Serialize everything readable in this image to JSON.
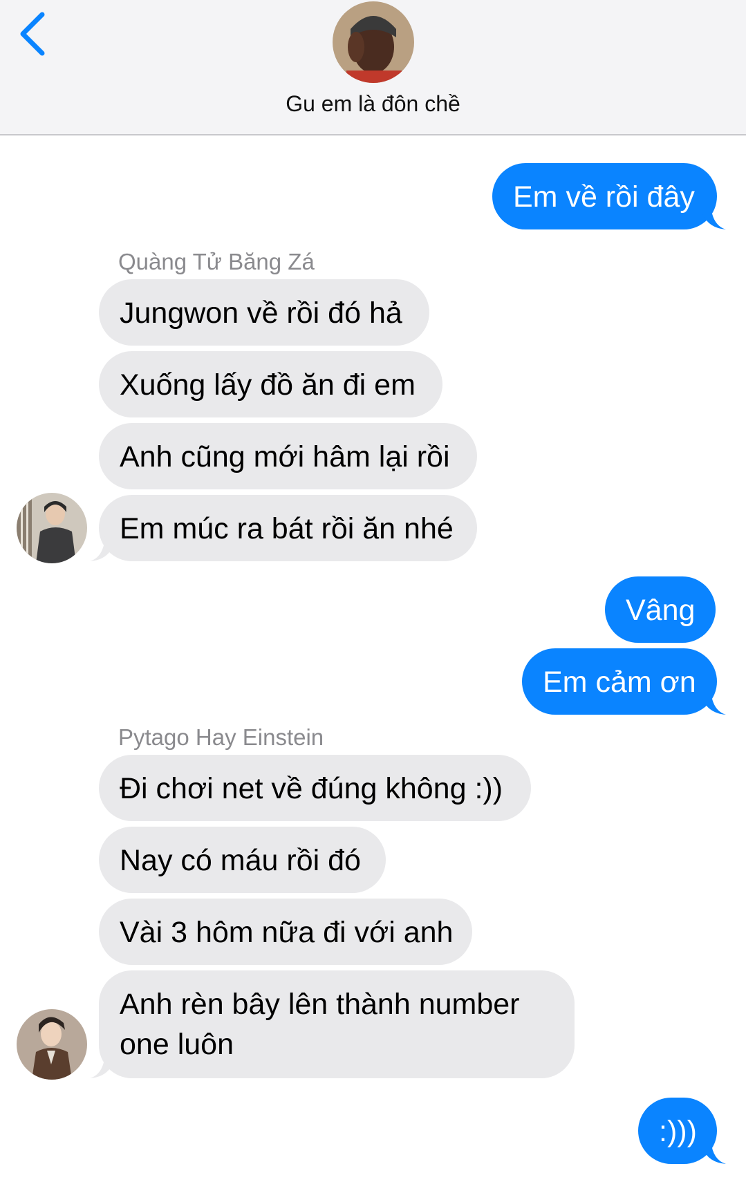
{
  "header": {
    "title": "Gu em là đôn chề",
    "back_icon": "chevron-left-icon"
  },
  "colors": {
    "accent": "#0a84ff",
    "incoming_bubble": "#e9e9eb",
    "header_bg": "#f4f4f6"
  },
  "messages": [
    {
      "direction": "out",
      "text": "Em về rồi đây"
    },
    {
      "direction": "in",
      "sender": "Quàng Tử Băng Zá",
      "texts": [
        "Jungwon về rồi đó hả",
        "Xuống lấy đồ ăn đi em",
        "Anh cũng mới hâm lại rồi",
        "Em múc ra bát rồi ăn nhé"
      ]
    },
    {
      "direction": "out",
      "texts": [
        "Vâng",
        "Em cảm ơn"
      ]
    },
    {
      "direction": "in",
      "sender": "Pytago Hay Einstein",
      "texts": [
        "Đi chơi net về đúng không :))",
        "Nay có máu rồi đó",
        "Vài 3 hôm nữa đi với anh",
        "Anh rèn bây lên thành number one luôn"
      ]
    },
    {
      "direction": "out",
      "text": ":)))"
    }
  ]
}
